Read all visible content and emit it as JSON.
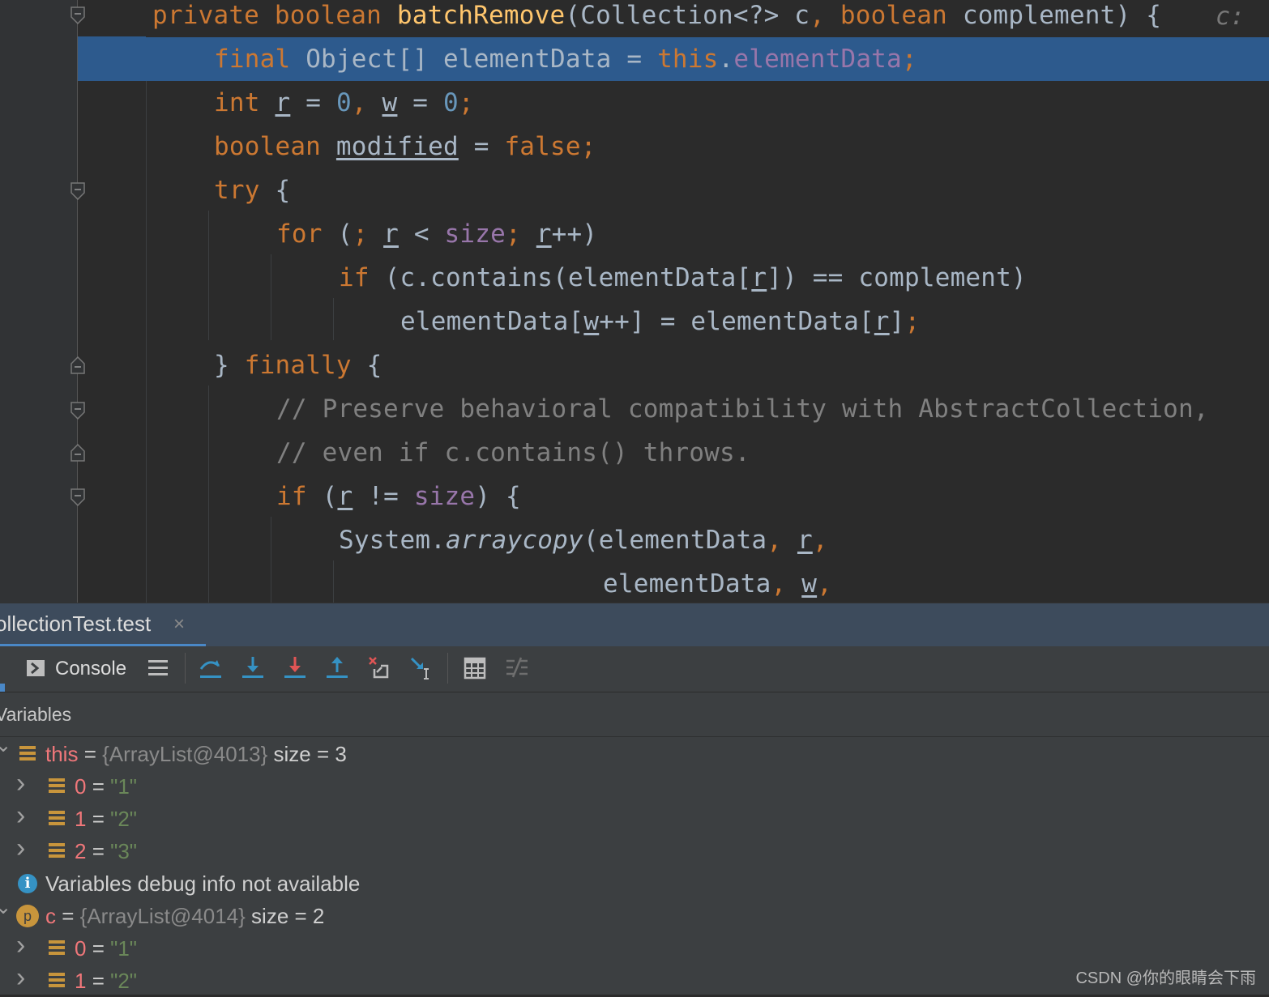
{
  "editor": {
    "hint": "c:",
    "lines": [
      {
        "segments": [
          {
            "t": "private ",
            "c": "k"
          },
          {
            "t": "boolean ",
            "c": "k"
          },
          {
            "t": "batchRemove",
            "c": "f"
          },
          {
            "t": "(Collection<?> c",
            "c": ""
          },
          {
            "t": ", ",
            "c": "k"
          },
          {
            "t": "boolean ",
            "c": "k"
          },
          {
            "t": "complement) {",
            "c": ""
          }
        ]
      },
      {
        "segments": [
          {
            "t": "final ",
            "c": "k"
          },
          {
            "t": "Object[] elementData = ",
            "c": ""
          },
          {
            "t": "this",
            "c": "k"
          },
          {
            "t": ".",
            "c": ""
          },
          {
            "t": "elementData",
            "c": "p"
          },
          {
            "t": ";",
            "c": "k"
          }
        ]
      },
      {
        "segments": [
          {
            "t": "int ",
            "c": "k"
          },
          {
            "t": "r",
            "c": "u"
          },
          {
            "t": " = ",
            "c": ""
          },
          {
            "t": "0",
            "c": "n"
          },
          {
            "t": ", ",
            "c": "k"
          },
          {
            "t": "w",
            "c": "u"
          },
          {
            "t": " = ",
            "c": ""
          },
          {
            "t": "0",
            "c": "n"
          },
          {
            "t": ";",
            "c": "k"
          }
        ]
      },
      {
        "segments": [
          {
            "t": "boolean ",
            "c": "k"
          },
          {
            "t": "modified",
            "c": "u"
          },
          {
            "t": " = ",
            "c": ""
          },
          {
            "t": "false",
            "c": "k"
          },
          {
            "t": ";",
            "c": "k"
          }
        ]
      },
      {
        "segments": [
          {
            "t": "try ",
            "c": "k"
          },
          {
            "t": "{",
            "c": ""
          }
        ]
      },
      {
        "segments": [
          {
            "t": "for ",
            "c": "k"
          },
          {
            "t": "(",
            "c": ""
          },
          {
            "t": "; ",
            "c": "k"
          },
          {
            "t": "r",
            "c": "u"
          },
          {
            "t": " < ",
            "c": ""
          },
          {
            "t": "size",
            "c": "p"
          },
          {
            "t": "; ",
            "c": "k"
          },
          {
            "t": "r",
            "c": "u"
          },
          {
            "t": "++)",
            "c": ""
          }
        ]
      },
      {
        "segments": [
          {
            "t": "if ",
            "c": "k"
          },
          {
            "t": "(c.contains(elementData[",
            "c": ""
          },
          {
            "t": "r",
            "c": "u"
          },
          {
            "t": "]) == complement)",
            "c": ""
          }
        ]
      },
      {
        "segments": [
          {
            "t": "elementData[",
            "c": ""
          },
          {
            "t": "w",
            "c": "u"
          },
          {
            "t": "++] = elementData[",
            "c": ""
          },
          {
            "t": "r",
            "c": "u"
          },
          {
            "t": "]",
            "c": ""
          },
          {
            "t": ";",
            "c": "k"
          }
        ]
      },
      {
        "segments": [
          {
            "t": "} ",
            "c": ""
          },
          {
            "t": "finally ",
            "c": "k"
          },
          {
            "t": "{",
            "c": ""
          }
        ]
      },
      {
        "segments": [
          {
            "t": "// Preserve behavioral compatibility with AbstractCollection,",
            "c": "c"
          }
        ]
      },
      {
        "segments": [
          {
            "t": "// even if c.contains() throws.",
            "c": "c"
          }
        ]
      },
      {
        "segments": [
          {
            "t": "if ",
            "c": "k"
          },
          {
            "t": "(",
            "c": ""
          },
          {
            "t": "r",
            "c": "u"
          },
          {
            "t": " != ",
            "c": ""
          },
          {
            "t": "size",
            "c": "p"
          },
          {
            "t": ") {",
            "c": ""
          }
        ]
      },
      {
        "segments": [
          {
            "t": "System.",
            "c": ""
          },
          {
            "t": "arraycopy",
            "c": "i"
          },
          {
            "t": "(elementData",
            "c": ""
          },
          {
            "t": ", ",
            "c": "k"
          },
          {
            "t": "r",
            "c": "u"
          },
          {
            "t": ",",
            "c": "k"
          }
        ]
      },
      {
        "segments": [
          {
            "t": "elementData",
            "c": ""
          },
          {
            "t": ", ",
            "c": "k"
          },
          {
            "t": "w",
            "c": "u"
          },
          {
            "t": ",",
            "c": "k"
          }
        ]
      }
    ]
  },
  "debug": {
    "tab_label": "ollectionTest.test",
    "tab_close": "×",
    "console_label": "Console",
    "variables_title": "Variables",
    "rows": [
      {
        "kind": "field",
        "expanded": true,
        "name": "this",
        "eq": " = ",
        "type": "{ArrayList@4013}",
        "extra": "  size = 3"
      },
      {
        "kind": "field",
        "child": true,
        "name": "0",
        "eq": " = ",
        "str": "\"1\""
      },
      {
        "kind": "field",
        "child": true,
        "name": "1",
        "eq": " = ",
        "str": "\"2\""
      },
      {
        "kind": "field",
        "child": true,
        "name": "2",
        "eq": " = ",
        "str": "\"3\""
      },
      {
        "kind": "info",
        "text": "Variables debug info not available"
      },
      {
        "kind": "param",
        "expanded": true,
        "icon_letter": "p",
        "name": "c",
        "eq": " = ",
        "type": "{ArrayList@4014}",
        "extra": "  size = 2"
      },
      {
        "kind": "field",
        "child": true,
        "name": "0",
        "eq": " = ",
        "str": "\"1\""
      },
      {
        "kind": "field",
        "child": true,
        "name": "1",
        "eq": " = ",
        "str": "\"2\""
      }
    ]
  },
  "watermark": "CSDN @你的眼睛会下雨",
  "colors": {
    "selection": "#2d5a8d",
    "keyword": "#cc7832",
    "tab_accent": "#4a88c7"
  }
}
